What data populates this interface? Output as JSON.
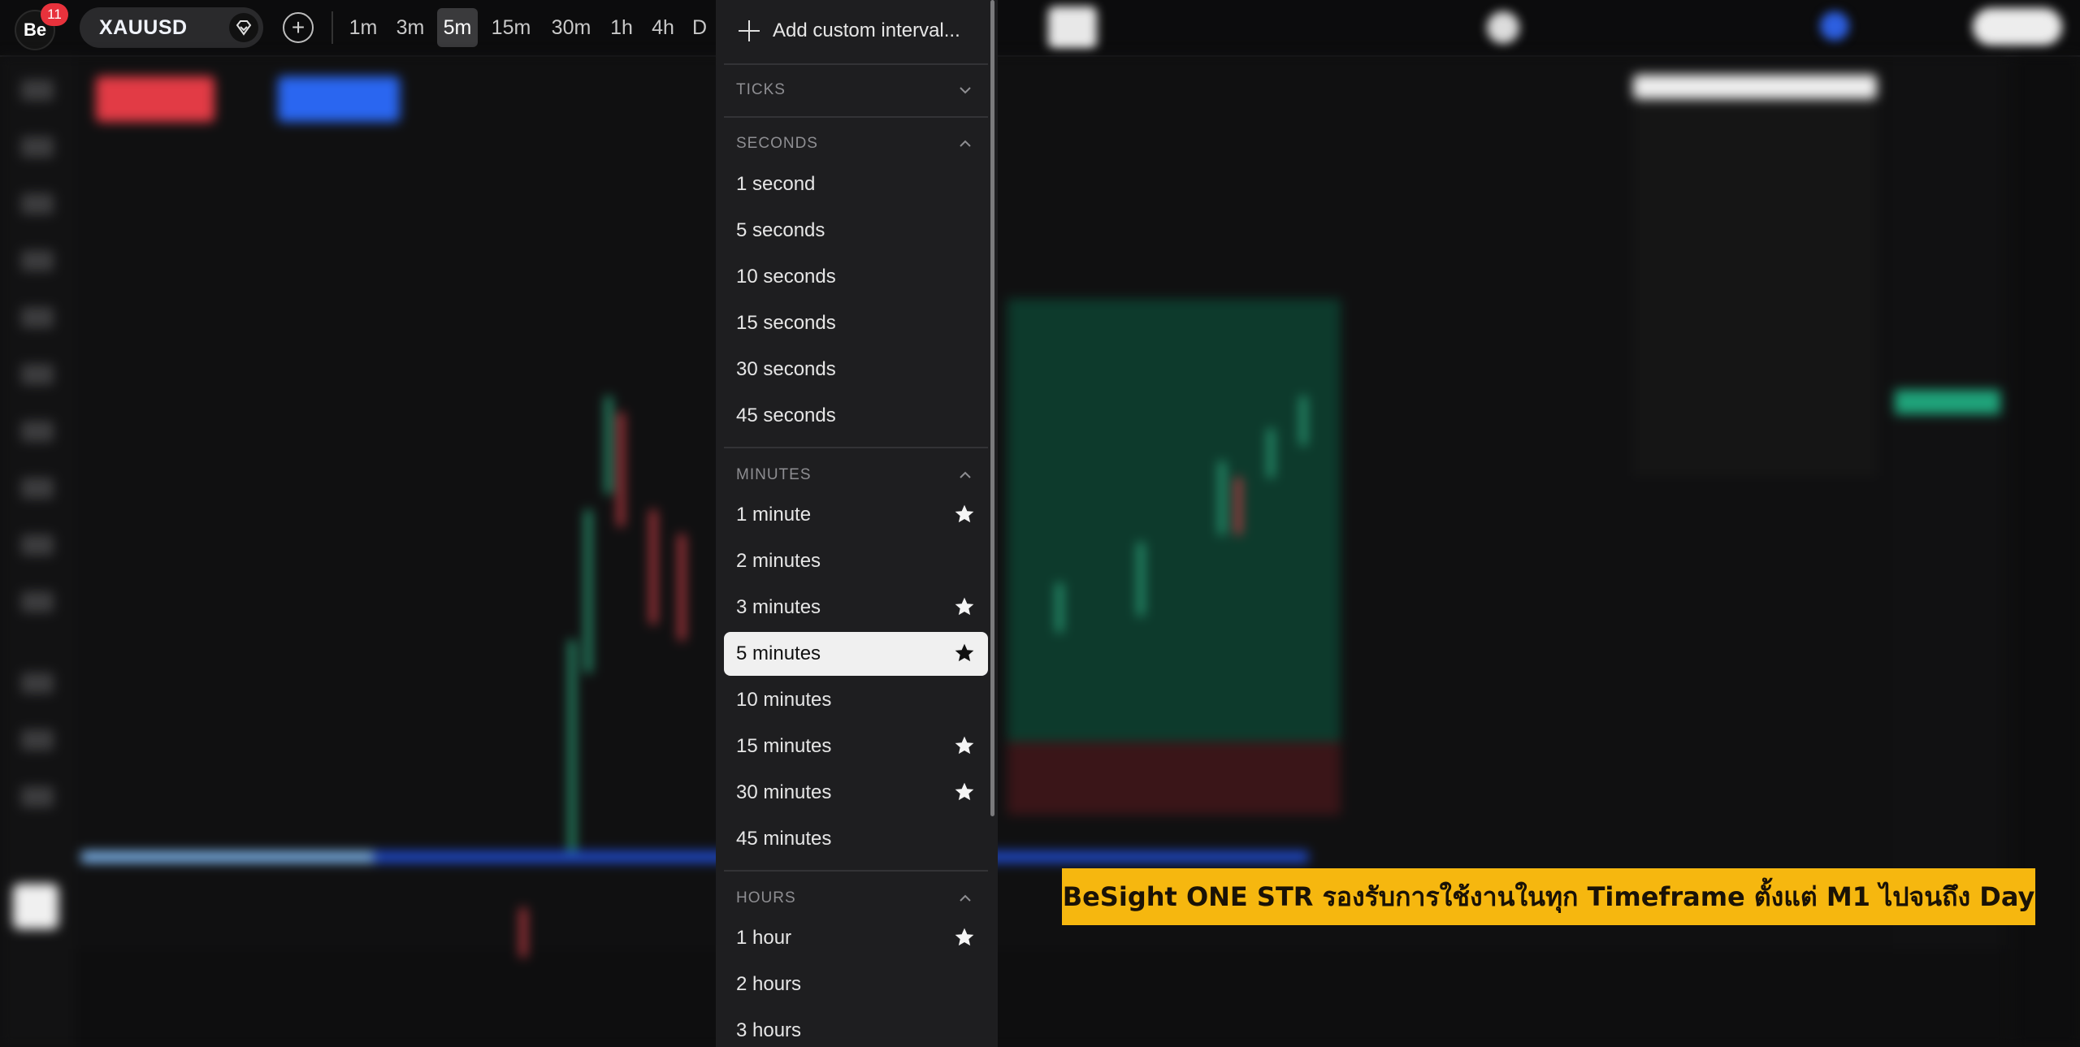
{
  "topbar": {
    "logo_text": "Be",
    "notification_count": "11",
    "symbol": "XAUUSD",
    "intervals": [
      "1m",
      "3m",
      "5m",
      "15m",
      "30m",
      "1h",
      "4h",
      "D"
    ],
    "active_interval": "5m"
  },
  "dropdown": {
    "add_custom_label": "Add custom interval...",
    "sections": {
      "ticks": {
        "title": "TICKS",
        "expanded": false
      },
      "seconds": {
        "title": "SECONDS",
        "expanded": true,
        "items": [
          {
            "label": "1 second",
            "starred": false
          },
          {
            "label": "5 seconds",
            "starred": false
          },
          {
            "label": "10 seconds",
            "starred": false
          },
          {
            "label": "15 seconds",
            "starred": false
          },
          {
            "label": "30 seconds",
            "starred": false
          },
          {
            "label": "45 seconds",
            "starred": false
          }
        ]
      },
      "minutes": {
        "title": "MINUTES",
        "expanded": true,
        "items": [
          {
            "label": "1 minute",
            "starred": true
          },
          {
            "label": "2 minutes",
            "starred": false
          },
          {
            "label": "3 minutes",
            "starred": true
          },
          {
            "label": "5 minutes",
            "starred": true,
            "selected": true
          },
          {
            "label": "10 minutes",
            "starred": false
          },
          {
            "label": "15 minutes",
            "starred": true
          },
          {
            "label": "30 minutes",
            "starred": true
          },
          {
            "label": "45 minutes",
            "starred": false
          }
        ]
      },
      "hours": {
        "title": "HOURS",
        "expanded": true,
        "items": [
          {
            "label": "1 hour",
            "starred": true
          },
          {
            "label": "2 hours",
            "starred": false
          },
          {
            "label": "3 hours",
            "starred": false
          }
        ]
      }
    }
  },
  "caption": "BeSight ONE STR รองรับการใช้งานในทุก Timeframe ตั้งแต่ M1 ไปจนถึง Day",
  "colors": {
    "caption_bg": "#f6b70f",
    "dropdown_bg": "#1e1e20",
    "selected_bg": "#f0f0f0",
    "badge": "#e8323c"
  }
}
